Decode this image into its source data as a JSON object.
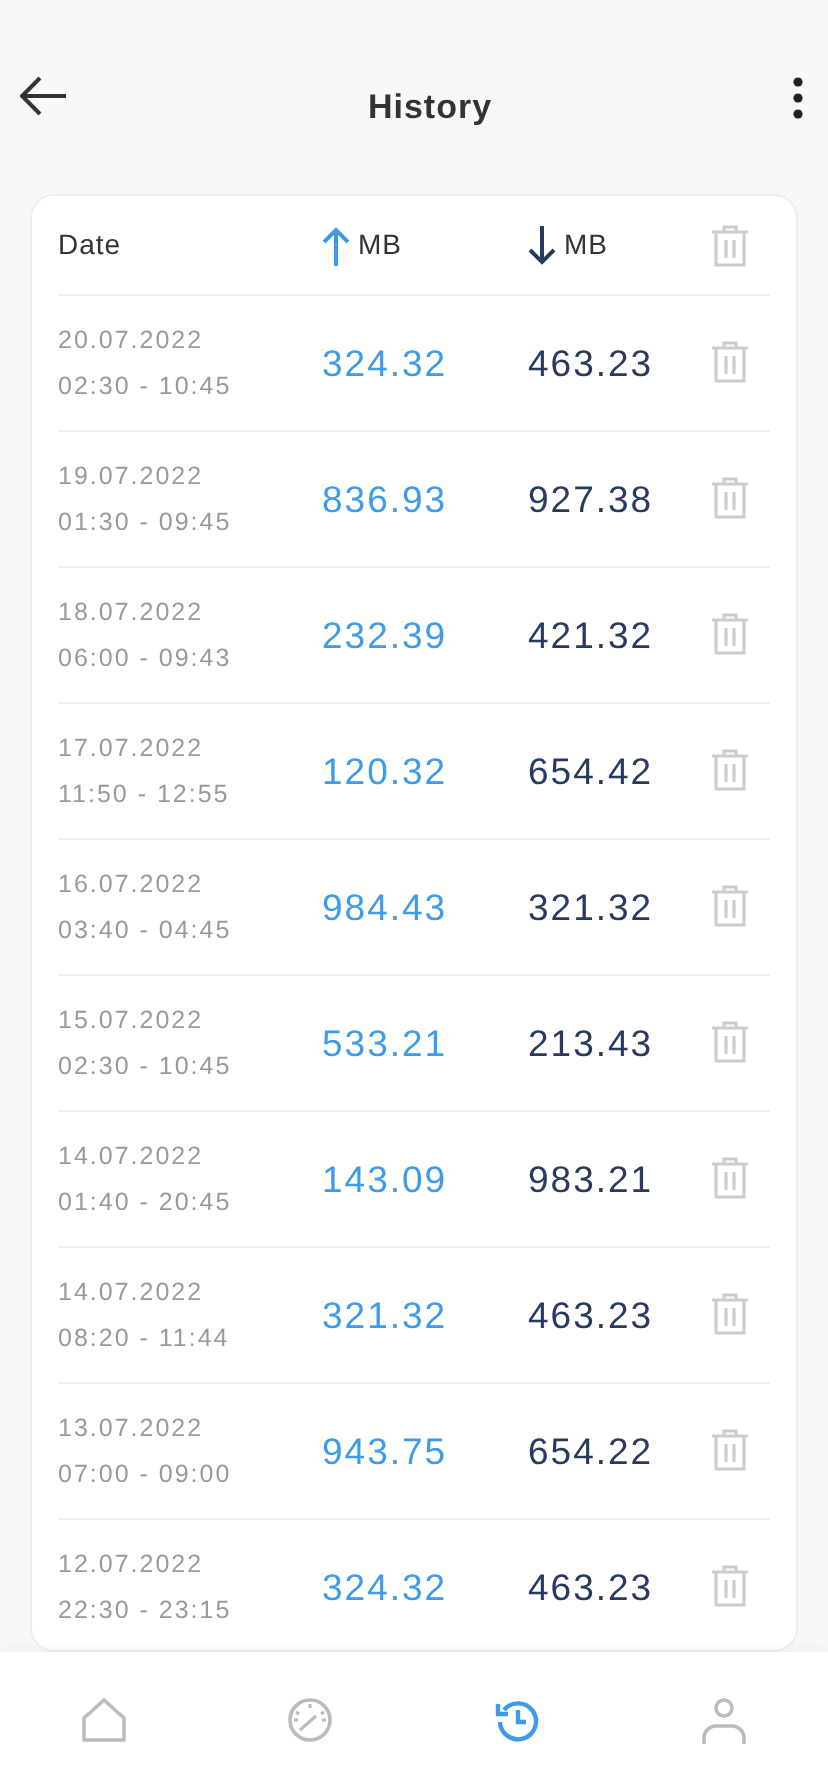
{
  "header": {
    "title": "History"
  },
  "table": {
    "columns": [
      {
        "kind": "date",
        "label": "Date"
      },
      {
        "kind": "up",
        "label": "MB"
      },
      {
        "kind": "down",
        "label": "MB"
      },
      {
        "kind": "delete"
      }
    ],
    "rows": [
      {
        "date": "20.07.2022",
        "time": "02:30 - 10:45",
        "up": "324.32",
        "down": "463.23"
      },
      {
        "date": "19.07.2022",
        "time": "01:30 - 09:45",
        "up": "836.93",
        "down": "927.38"
      },
      {
        "date": "18.07.2022",
        "time": "06:00 - 09:43",
        "up": "232.39",
        "down": "421.32"
      },
      {
        "date": "17.07.2022",
        "time": "11:50 - 12:55",
        "up": "120.32",
        "down": "654.42"
      },
      {
        "date": "16.07.2022",
        "time": "03:40 - 04:45",
        "up": "984.43",
        "down": "321.32"
      },
      {
        "date": "15.07.2022",
        "time": "02:30 - 10:45",
        "up": "533.21",
        "down": "213.43"
      },
      {
        "date": "14.07.2022",
        "time": "01:40 - 20:45",
        "up": "143.09",
        "down": "983.21"
      },
      {
        "date": "14.07.2022",
        "time": "08:20 - 11:44",
        "up": "321.32",
        "down": "463.23"
      },
      {
        "date": "13.07.2022",
        "time": "07:00 - 09:00",
        "up": "943.75",
        "down": "654.22"
      },
      {
        "date": "12.07.2022",
        "time": "22:30 - 23:15",
        "up": "324.32",
        "down": "463.23"
      }
    ]
  },
  "nav": [
    {
      "kind": "home",
      "selected": false
    },
    {
      "kind": "speed",
      "selected": false
    },
    {
      "kind": "history",
      "selected": true
    },
    {
      "kind": "profile",
      "selected": false
    }
  ]
}
